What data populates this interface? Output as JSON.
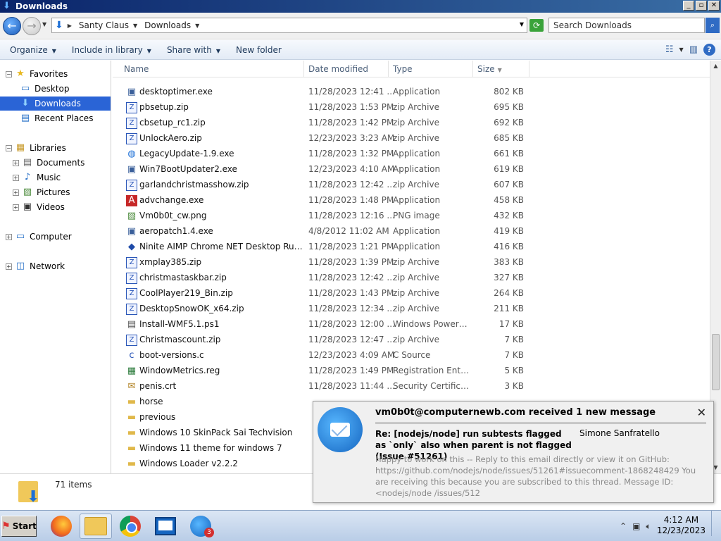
{
  "window": {
    "title": "Downloads",
    "buttons": {
      "minimize": "_",
      "maximize": "▫",
      "close": "✕"
    }
  },
  "address": {
    "crumbs": [
      "Santy Claus",
      "Downloads"
    ],
    "search_placeholder": "Search Downloads"
  },
  "toolbar": {
    "organize": "Organize",
    "include": "Include in library",
    "share": "Share with",
    "newfolder": "New folder"
  },
  "nav": {
    "favorites": "Favorites",
    "desktop": "Desktop",
    "downloads": "Downloads",
    "recent": "Recent Places",
    "libraries": "Libraries",
    "documents": "Documents",
    "music": "Music",
    "pictures": "Pictures",
    "videos": "Videos",
    "computer": "Computer",
    "network": "Network"
  },
  "columns": {
    "name": "Name",
    "date": "Date modified",
    "type": "Type",
    "size": "Size"
  },
  "files": [
    {
      "name": "desktoptimer.exe",
      "date": "11/28/2023 12:41 ...",
      "type": "Application",
      "size": "802 KB",
      "icon": "app"
    },
    {
      "name": "pbsetup.zip",
      "date": "11/28/2023 1:53 PM",
      "type": "zip Archive",
      "size": "695 KB",
      "icon": "zip"
    },
    {
      "name": "cbsetup_rc1.zip",
      "date": "11/28/2023 1:42 PM",
      "type": "zip Archive",
      "size": "692 KB",
      "icon": "zip"
    },
    {
      "name": "UnlockAero.zip",
      "date": "12/23/2023 3:23 AM",
      "type": "zip Archive",
      "size": "685 KB",
      "icon": "zip"
    },
    {
      "name": "LegacyUpdate-1.9.exe",
      "date": "11/28/2023 1:32 PM",
      "type": "Application",
      "size": "661 KB",
      "icon": "globe"
    },
    {
      "name": "Win7BootUpdater2.exe",
      "date": "12/23/2023 4:10 AM",
      "type": "Application",
      "size": "619 KB",
      "icon": "app"
    },
    {
      "name": "garlandchristmasshow.zip",
      "date": "11/28/2023 12:42 ...",
      "type": "zip Archive",
      "size": "607 KB",
      "icon": "zip"
    },
    {
      "name": "advchange.exe",
      "date": "11/28/2023 1:48 PM",
      "type": "Application",
      "size": "458 KB",
      "icon": "aplus"
    },
    {
      "name": "Vm0b0t_cw.png",
      "date": "11/28/2023 12:16 ...",
      "type": "PNG image",
      "size": "432 KB",
      "icon": "image"
    },
    {
      "name": "aeropatch1.4.exe",
      "date": "4/8/2012 11:02 AM",
      "type": "Application",
      "size": "419 KB",
      "icon": "app"
    },
    {
      "name": "Ninite AIMP Chrome NET Desktop Runti...",
      "date": "11/28/2023 1:21 PM",
      "type": "Application",
      "size": "416 KB",
      "icon": "ninite"
    },
    {
      "name": "xmplay385.zip",
      "date": "11/28/2023 1:39 PM",
      "type": "zip Archive",
      "size": "383 KB",
      "icon": "zip"
    },
    {
      "name": "christmastaskbar.zip",
      "date": "11/28/2023 12:42 ...",
      "type": "zip Archive",
      "size": "327 KB",
      "icon": "zip"
    },
    {
      "name": "CoolPlayer219_Bin.zip",
      "date": "11/28/2023 1:43 PM",
      "type": "zip Archive",
      "size": "264 KB",
      "icon": "zip"
    },
    {
      "name": "DesktopSnowOK_x64.zip",
      "date": "11/28/2023 12:34 ...",
      "type": "zip Archive",
      "size": "211 KB",
      "icon": "zip"
    },
    {
      "name": "Install-WMF5.1.ps1",
      "date": "11/28/2023 12:00 ...",
      "type": "Windows PowerS...",
      "size": "17 KB",
      "icon": "script"
    },
    {
      "name": "Christmascount.zip",
      "date": "11/28/2023 12:47 ...",
      "type": "zip Archive",
      "size": "7 KB",
      "icon": "zip"
    },
    {
      "name": "boot-versions.c",
      "date": "12/23/2023 4:09 AM",
      "type": "C Source",
      "size": "7 KB",
      "icon": "c"
    },
    {
      "name": "WindowMetrics.reg",
      "date": "11/28/2023 1:49 PM",
      "type": "Registration Entries",
      "size": "5 KB",
      "icon": "reg"
    },
    {
      "name": "penis.crt",
      "date": "11/28/2023 11:44 ...",
      "type": "Security Certificate",
      "size": "3 KB",
      "icon": "cert"
    },
    {
      "name": "horse",
      "date": "",
      "type": "",
      "size": "",
      "icon": "folder"
    },
    {
      "name": "previous",
      "date": "",
      "type": "",
      "size": "",
      "icon": "folder"
    },
    {
      "name": "Windows 10 SkinPack Sai Techvision",
      "date": "",
      "type": "",
      "size": "",
      "icon": "folder"
    },
    {
      "name": "Windows 11 theme for windows 7",
      "date": "",
      "type": "",
      "size": "",
      "icon": "folder"
    },
    {
      "name": "Windows Loader v2.2.2",
      "date": "",
      "type": "",
      "size": "",
      "icon": "folder"
    }
  ],
  "details": {
    "count": "71 items"
  },
  "notification": {
    "title": "vm0b0t@computernewb.com received 1 new message",
    "subject": "Re: [nodejs/node] run subtests flagged as `only` also when parent is not flagged (Issue #51261)",
    "from": "Simone Sanfratello",
    "body": "Happy to work on this -- Reply to this email directly or view it on GitHub: https://github.com/nodejs/node/issues/51261#issuecomment-1868248429 You are receiving this because you are subscribed to this thread. Message ID: <nodejs/node /issues/512",
    "close": "✕"
  },
  "taskbar": {
    "start": "Start",
    "badge": "3",
    "time": "4:12 AM",
    "date": "12/23/2023"
  }
}
